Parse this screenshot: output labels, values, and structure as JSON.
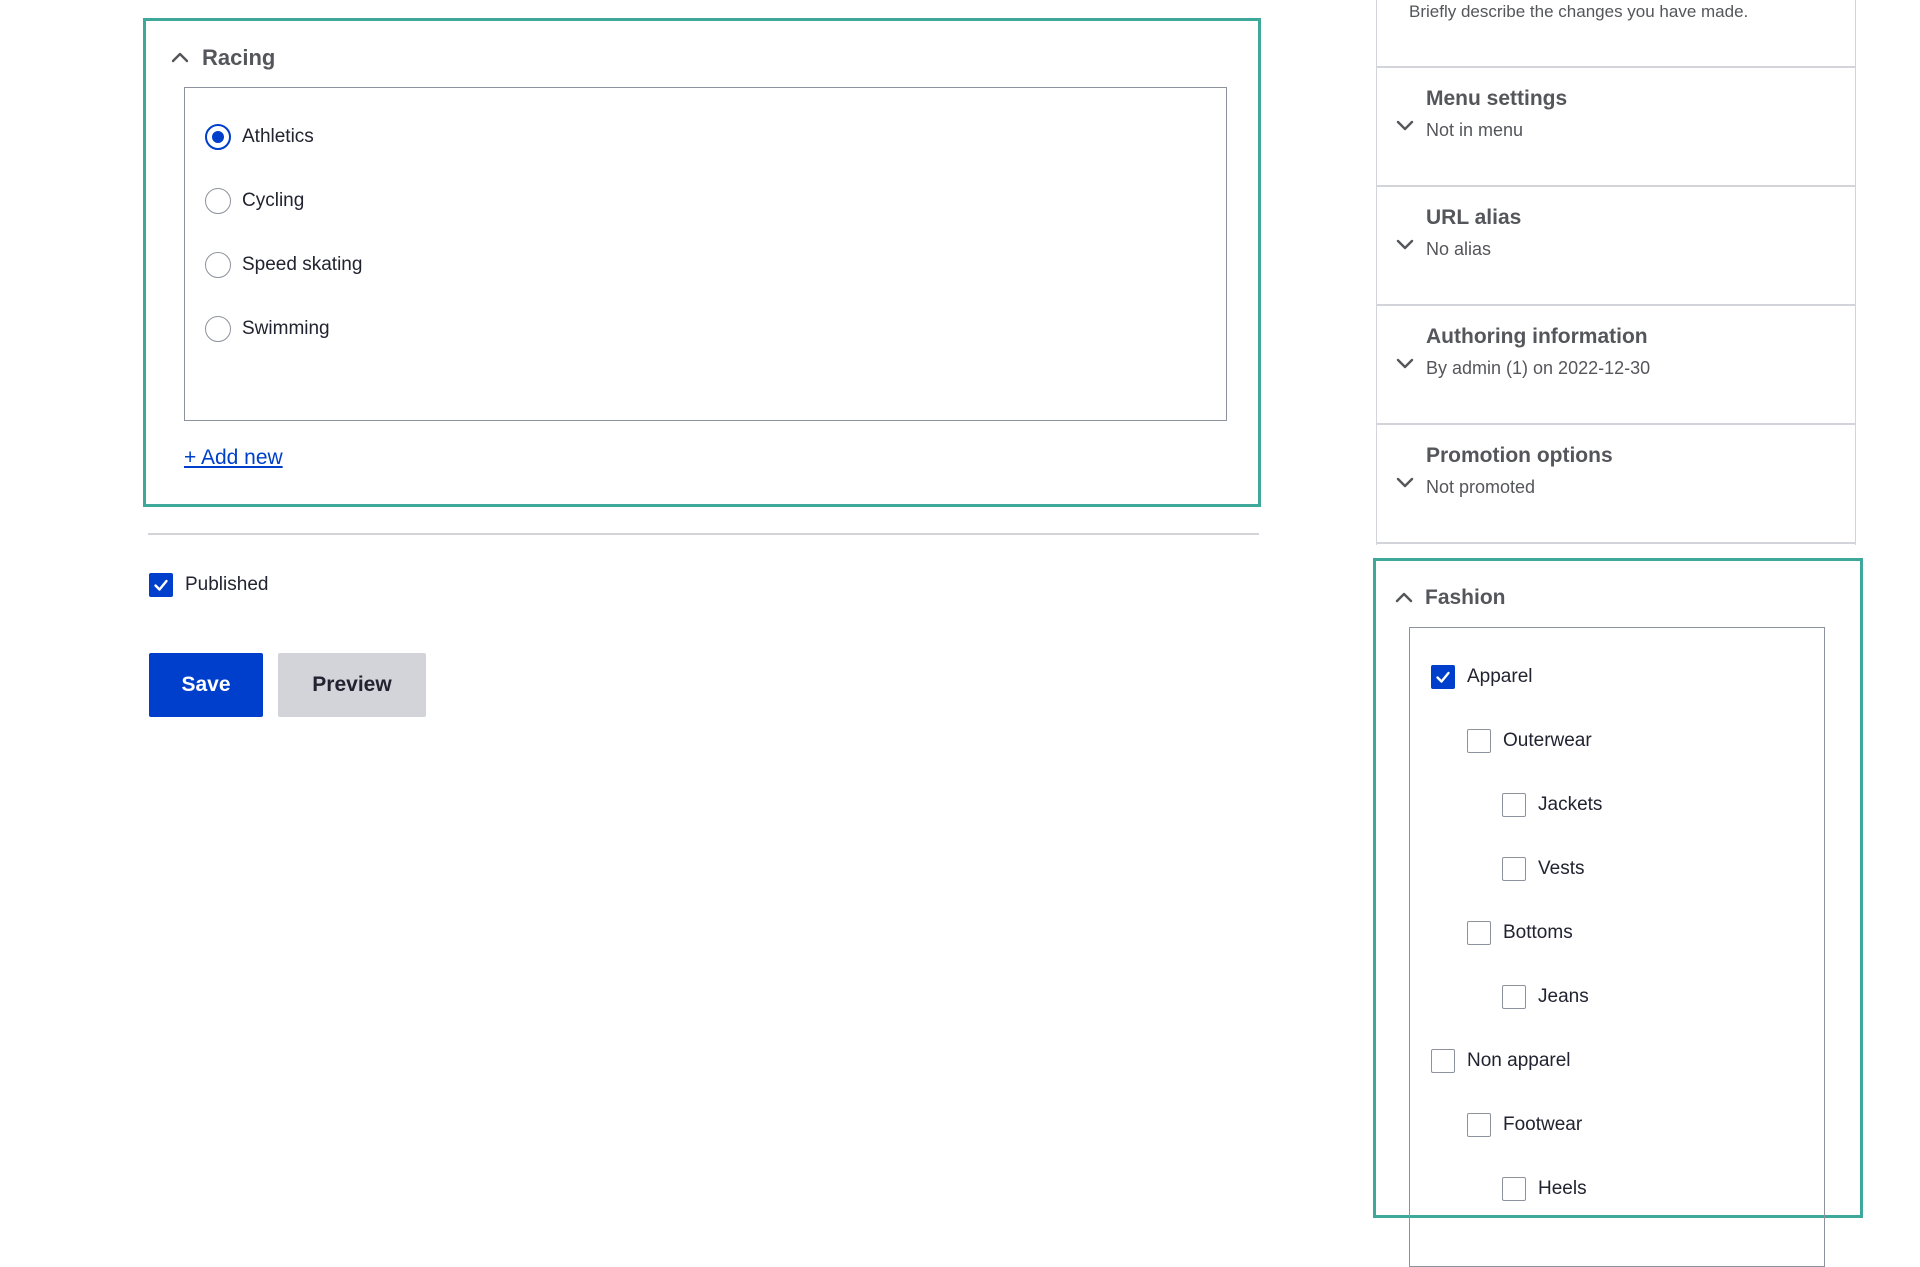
{
  "racing": {
    "title": "Racing",
    "options": [
      {
        "label": "Athletics",
        "selected": true
      },
      {
        "label": "Cycling",
        "selected": false
      },
      {
        "label": "Speed skating",
        "selected": false
      },
      {
        "label": "Swimming",
        "selected": false
      }
    ],
    "add_new_label": "+ Add new"
  },
  "published": {
    "label": "Published",
    "checked": true
  },
  "actions": {
    "save_label": "Save",
    "preview_label": "Preview"
  },
  "sidebar": {
    "revision_description": "Briefly describe the changes you have made.",
    "items": [
      {
        "title": "Menu settings",
        "summary": "Not in menu"
      },
      {
        "title": "URL alias",
        "summary": "No alias"
      },
      {
        "title": "Authoring information",
        "summary": "By admin (1) on 2022-12-30"
      },
      {
        "title": "Promotion options",
        "summary": "Not promoted"
      }
    ]
  },
  "fashion": {
    "title": "Fashion",
    "options": [
      {
        "label": "Apparel",
        "checked": true,
        "depth": 0
      },
      {
        "label": "Outerwear",
        "checked": false,
        "depth": 1
      },
      {
        "label": "Jackets",
        "checked": false,
        "depth": 2
      },
      {
        "label": "Vests",
        "checked": false,
        "depth": 2
      },
      {
        "label": "Bottoms",
        "checked": false,
        "depth": 1
      },
      {
        "label": "Jeans",
        "checked": false,
        "depth": 2
      },
      {
        "label": "Non apparel",
        "checked": false,
        "depth": 0
      },
      {
        "label": "Footwear",
        "checked": false,
        "depth": 1
      },
      {
        "label": "Heels",
        "checked": false,
        "depth": 2
      }
    ]
  },
  "colors": {
    "accent": "#003ecc",
    "focus_outline": "#3ea99b",
    "border": "#8e929c",
    "muted_text": "#55565b"
  },
  "icons": {
    "expanded": "chevron-up-icon",
    "collapsed": "chevron-down-icon",
    "check": "checkmark-icon"
  }
}
